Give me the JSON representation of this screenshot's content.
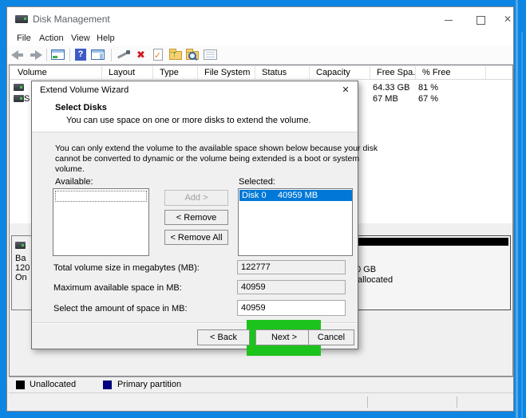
{
  "colors": {
    "desktop_blue": "#0c86e2",
    "selection_blue": "#0078d7",
    "highlight_green": "#1dc31d"
  },
  "window": {
    "title": "Disk Management",
    "menu_items": [
      "File",
      "Action",
      "View",
      "Help"
    ]
  },
  "volume_table": {
    "columns": [
      "Volume",
      "Layout",
      "Type",
      "File System",
      "Status",
      "Capacity",
      "Free Spa...",
      "% Free"
    ],
    "rows": [
      {
        "volume_fragment": "",
        "free_space": "64.33 GB",
        "percent_free": "81 %"
      },
      {
        "volume_fragment": "S",
        "free_space": "67 MB",
        "percent_free": "67 %"
      }
    ]
  },
  "disk_pane": {
    "info_fragments": {
      "line1": "Ba",
      "line2": "120",
      "line3": "On"
    },
    "partition": {
      "size_fragment": "0 GB",
      "label": "Unallocated"
    }
  },
  "legend": {
    "items": [
      {
        "label": "Unallocated",
        "color": "#000000"
      },
      {
        "label": "Primary partition",
        "color": "#000080"
      }
    ]
  },
  "dialog": {
    "title": "Extend Volume Wizard",
    "close_glyph": "✕",
    "heading": "Select Disks",
    "subheading": "You can use space on one or more disks to extend the volume.",
    "body_lines": {
      "line1": "You can only extend the volume to the available space shown below because your disk",
      "line2": "cannot be converted to dynamic or the volume being extended is a boot or system",
      "line3": "volume."
    },
    "available_label": "Available:",
    "selected_label": "Selected:",
    "selected_items": [
      {
        "name": "Disk 0",
        "size": "40959 MB"
      }
    ],
    "buttons": {
      "add": "Add >",
      "remove": "< Remove",
      "remove_all": "< Remove All",
      "back": "< Back",
      "next": "Next >",
      "cancel": "Cancel"
    },
    "fields": [
      {
        "label": "Total volume size in megabytes (MB):",
        "value": "122777"
      },
      {
        "label": "Maximum available space in MB:",
        "value": "40959"
      },
      {
        "label": "Select the amount of space in MB:",
        "value": "40959"
      }
    ]
  }
}
